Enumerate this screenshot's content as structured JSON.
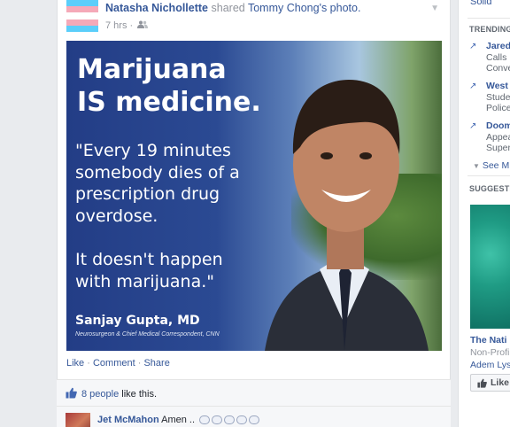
{
  "post": {
    "author": "Natasha Nichollette",
    "action": "shared",
    "shared_from": "Tommy Chong's photo.",
    "time": "7 hrs",
    "time_sep": "·",
    "photo": {
      "headline": "Marijuana\nIS medicine.",
      "quote": "\"Every 19 minutes\nsomebody dies of a\nprescription drug\noverdose.\n\nIt doesn't happen\nwith marijuana.\"",
      "attribution_name": "Sanjay Gupta, MD",
      "attribution_title": "Neurosurgeon & Chief Medical Correspondent, CNN"
    },
    "actions": {
      "like": "Like",
      "comment": "Comment",
      "share": "Share",
      "sep": "·"
    },
    "likes": {
      "count": "8 people",
      "suffix": "like this."
    },
    "comment": {
      "author": "Jet McMahon",
      "text": "Amen .."
    }
  },
  "sidebar": {
    "top_item": "Solid",
    "trending_title": "TRENDING",
    "trends": [
      {
        "title": "Jared",
        "desc1": "Calls",
        "desc2": "Conve"
      },
      {
        "title": "West",
        "desc1": "Stude",
        "desc2": "Police"
      },
      {
        "title": "Doom",
        "desc1": "Appea",
        "desc2": "Super"
      }
    ],
    "see_more": "See M",
    "suggested_title": "SUGGESTE",
    "suggestion": {
      "name": "The Nati",
      "category": "Non-Profi",
      "friend": "Adem Lys",
      "like_label": "Like"
    }
  },
  "colors": {
    "facebook_blue": "#365899",
    "flag_blue": "#5bcefa",
    "flag_pink": "#f5a9b8"
  }
}
